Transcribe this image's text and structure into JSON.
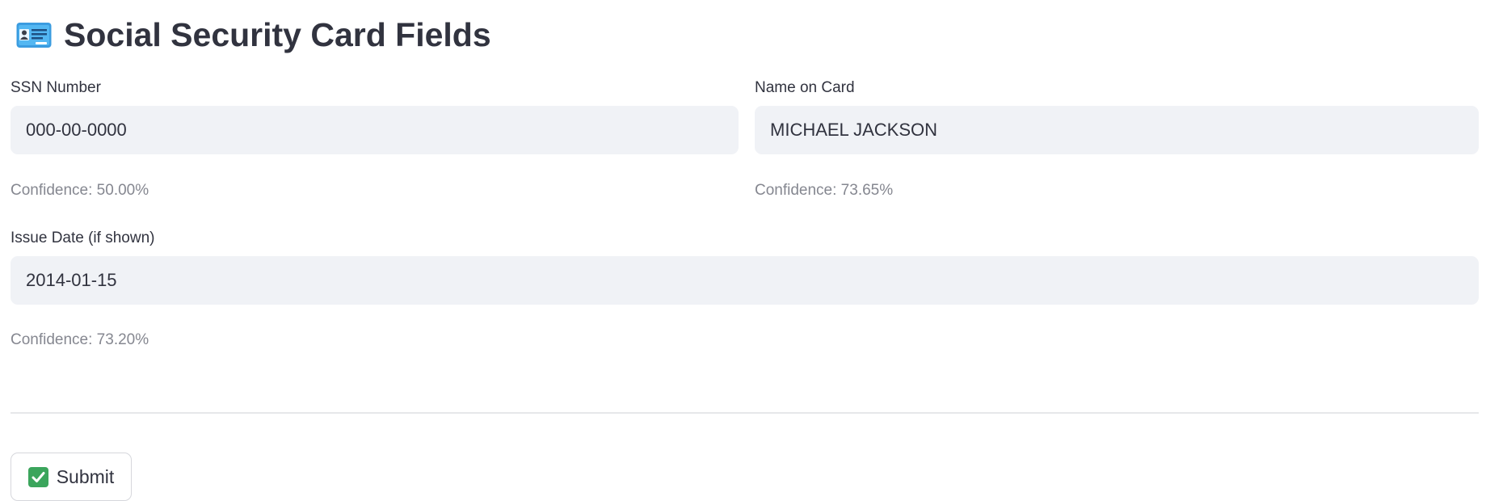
{
  "header": {
    "title": "Social Security Card Fields",
    "icon": "id-card-icon"
  },
  "fields": {
    "ssn": {
      "label": "SSN Number",
      "value": "000-00-0000",
      "confidence": "Confidence: 50.00%"
    },
    "name": {
      "label": "Name on Card",
      "value": "MICHAEL JACKSON",
      "confidence": "Confidence: 73.65%"
    },
    "issue_date": {
      "label": "Issue Date (if shown)",
      "value": "2014-01-15",
      "confidence": "Confidence: 73.20%"
    }
  },
  "actions": {
    "submit_label": "Submit",
    "submit_icon": "check-mark-icon"
  },
  "colors": {
    "text": "#31333f",
    "muted": "#858790",
    "input_bg": "#f0f2f6",
    "divider": "#e6e7ea",
    "check_green": "#3ba55c"
  }
}
